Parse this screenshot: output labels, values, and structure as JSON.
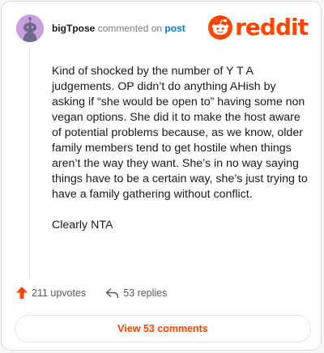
{
  "header": {
    "username": "bigTpose",
    "action_text": "commented on",
    "post_link": "post"
  },
  "logo": {
    "wordmark": "reddit",
    "color": "#ff4500"
  },
  "comment": {
    "paragraphs": [
      "Kind of shocked by the number of Y T A judgements. OP didn’t do anything AHish by asking if “she would be open to” having some non vegan options. She did it to make the host aware of potential problems because, as we know, older family members tend to get hostile when things aren’t the way they want. She’s in no way saying things have to be a certain way, she’s just trying to have a family gathering without conflict.",
      "Clearly NTA"
    ]
  },
  "actions": {
    "upvotes": "211 upvotes",
    "replies": "53 replies"
  },
  "view_button": {
    "label": "View 53 comments"
  },
  "icons": {
    "avatar": "snoo-avatar-icon",
    "logo": "reddit-snoo-icon",
    "upvote": "upvote-arrow-icon",
    "reply": "reply-arrow-icon"
  }
}
